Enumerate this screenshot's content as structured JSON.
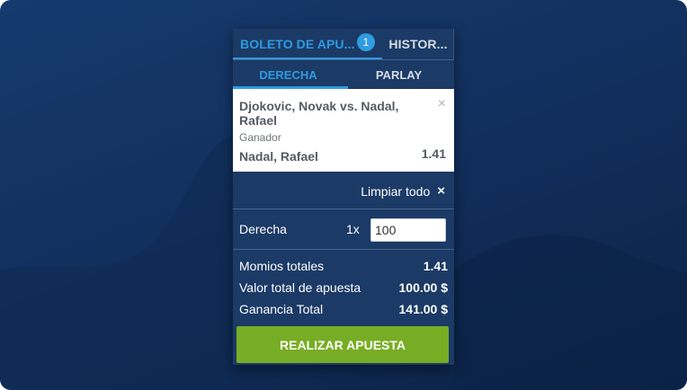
{
  "tabs": {
    "betslip_label": "BOLETO DE APU...",
    "badge_count": "1",
    "history_label": "HISTOR..."
  },
  "subtabs": {
    "straight_label": "DERECHA",
    "parlay_label": "PARLAY"
  },
  "bet": {
    "match": "Djokovic, Novak vs. Nadal, Rafael",
    "market": "Ganador",
    "selection": "Nadal, Rafael",
    "odds": "1.41",
    "close_icon": "×"
  },
  "clear": {
    "label": "Limpiar todo",
    "icon": "×"
  },
  "stake": {
    "label": "Derecha",
    "multiplier": "1x",
    "value": "100"
  },
  "totals": {
    "total_odds_label": "Momios totales",
    "total_odds_value": "1.41",
    "total_stake_label": "Valor total de apuesta",
    "total_stake_value": "100.00 $",
    "total_win_label": "Ganancia Total",
    "total_win_value": "141.00 $"
  },
  "place_bet_label": "REALIZAR APUESTA",
  "colors": {
    "accent": "#2f9be0",
    "panel": "#1b3a66",
    "button": "#77ad24"
  }
}
